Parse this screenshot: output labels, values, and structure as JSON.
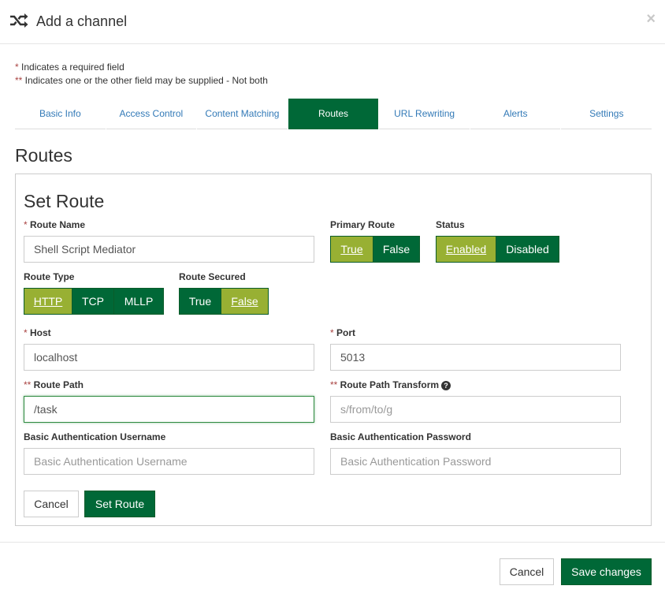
{
  "header": {
    "icon": "shuffle-icon",
    "title": "Add a channel",
    "close": "×"
  },
  "legend": {
    "required_marker": "*",
    "required_text": " Indicates a required field",
    "either_marker": "**",
    "either_text": " Indicates one or the other field may be supplied - Not both"
  },
  "tabs": [
    {
      "label": "Basic Info",
      "active": false
    },
    {
      "label": "Access Control",
      "active": false
    },
    {
      "label": "Content Matching",
      "active": false
    },
    {
      "label": "Routes",
      "active": true
    },
    {
      "label": "URL Rewriting",
      "active": false
    },
    {
      "label": "Alerts",
      "active": false
    },
    {
      "label": "Settings",
      "active": false
    }
  ],
  "section_title": "Routes",
  "route_form": {
    "title": "Set Route",
    "route_name": {
      "marker": "*",
      "label": " Route Name",
      "value": "Shell Script Mediator"
    },
    "primary_route": {
      "label": "Primary Route",
      "options": [
        "True",
        "False"
      ],
      "selected": "True"
    },
    "status": {
      "label": "Status",
      "options": [
        "Enabled",
        "Disabled"
      ],
      "selected": "Enabled"
    },
    "route_type": {
      "label": "Route Type",
      "options": [
        "HTTP",
        "TCP",
        "MLLP"
      ],
      "selected": "HTTP"
    },
    "route_secured": {
      "label": "Route Secured",
      "options": [
        "True",
        "False"
      ],
      "selected": "False"
    },
    "host": {
      "marker": "*",
      "label": " Host",
      "value": "localhost"
    },
    "port": {
      "marker": "*",
      "label": " Port",
      "value": "5013"
    },
    "route_path": {
      "marker": "**",
      "label": " Route Path",
      "value": "/task"
    },
    "route_path_transform": {
      "marker": "**",
      "label": " Route Path Transform",
      "help_icon": "?",
      "value": "",
      "placeholder": "s/from/to/g"
    },
    "basic_auth_username": {
      "label": "Basic Authentication Username",
      "value": "",
      "placeholder": "Basic Authentication Username"
    },
    "basic_auth_password": {
      "label": "Basic Authentication Password",
      "value": "",
      "placeholder": "Basic Authentication Password"
    },
    "cancel_label": "Cancel",
    "submit_label": "Set Route"
  },
  "footer": {
    "cancel_label": "Cancel",
    "save_label": "Save changes"
  },
  "colors": {
    "primary_green": "#006837",
    "selected_olive": "#98b033",
    "link_blue": "#337ab7",
    "required_red": "#a94442"
  }
}
